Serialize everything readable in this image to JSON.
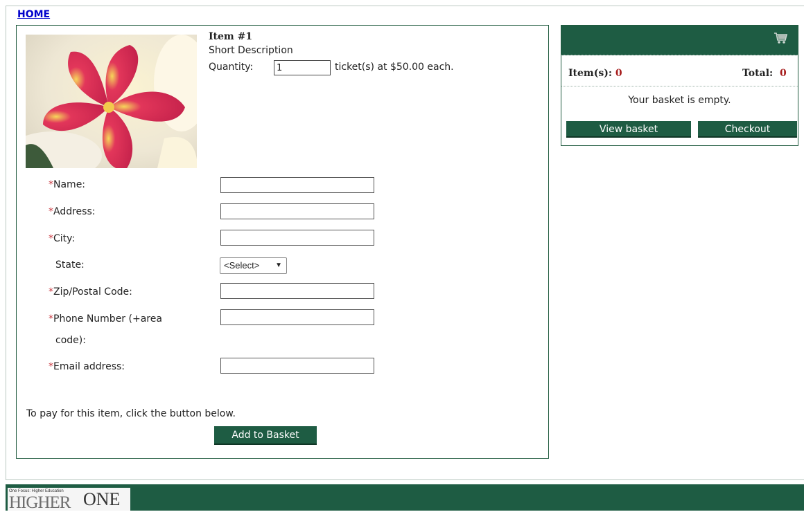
{
  "nav": {
    "home_label": "HOME"
  },
  "product": {
    "title": "Item #1",
    "description": "Short Description",
    "quantity_label": "Quantity:",
    "quantity_value": "1",
    "quantity_suffix": "ticket(s) at $50.00 each.",
    "image_alt": "pink-flower-photo"
  },
  "form": {
    "required_marker": "*",
    "name_label": "Name:",
    "address_label": "Address:",
    "city_label": "City:",
    "state_label": "State:",
    "state_selected": "<Select>",
    "zip_label": "Zip/Postal Code:",
    "phone_label_line1": "Phone Number (+area",
    "phone_label_line2": "code):",
    "email_label": "Email address:"
  },
  "pay": {
    "instruction": "To pay for this item, click the button below.",
    "add_button": "Add to Basket"
  },
  "basket": {
    "items_label": "Item(s):",
    "items_count": "0",
    "total_label": "Total:",
    "total_value": "0",
    "empty_message": "Your basket is empty.",
    "view_button": "View basket",
    "checkout_button": "Checkout",
    "icon": "cart-icon"
  },
  "footer": {
    "logo_tagline": "One Focus: Higher Education",
    "logo_word1": "HIGHER",
    "logo_word2": "ONE"
  },
  "colors": {
    "brand_green": "#1e5c43",
    "required_red": "#c8343c",
    "count_red": "#a61b1b",
    "link_blue": "#0000cc"
  }
}
